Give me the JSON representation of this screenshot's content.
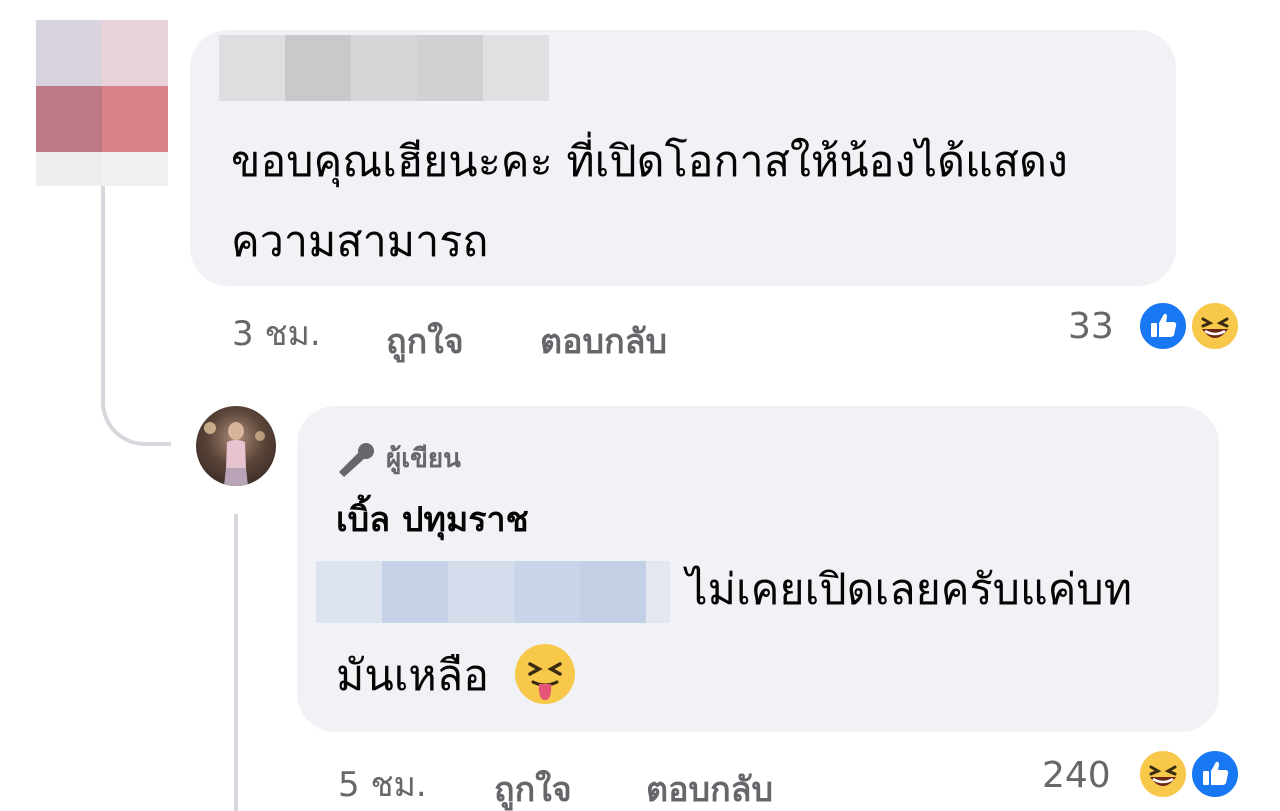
{
  "comment1": {
    "text": "ขอบคุณเฮียนะคะ ที่เปิดโอกาสให้น้องได้แสดงความสามารถ",
    "time": "3 ชม.",
    "like_label": "ถูกใจ",
    "reply_label": "ตอบกลับ",
    "reaction_count": "33",
    "reactions": [
      "like-icon",
      "haha-icon"
    ]
  },
  "comment2": {
    "badge": "ผู้เขียน",
    "author": "เบิ้ล ปทุมราช",
    "text_line1": "ไม่เคยเปิดเลยครับแค่บท",
    "text_line2": "มันเหลือ",
    "emoji": "squinting-face-with-tongue-icon",
    "time": "5 ชม.",
    "like_label": "ถูกใจ",
    "reply_label": "ตอบกลับ",
    "reaction_count": "240",
    "reactions": [
      "haha-icon",
      "like-icon"
    ]
  },
  "colors": {
    "bubble": "#f0f2f5",
    "like_blue": "#1877f2",
    "haha_yellow": "#f7c84a",
    "meta_gray": "#65676b",
    "text": "#050505"
  }
}
